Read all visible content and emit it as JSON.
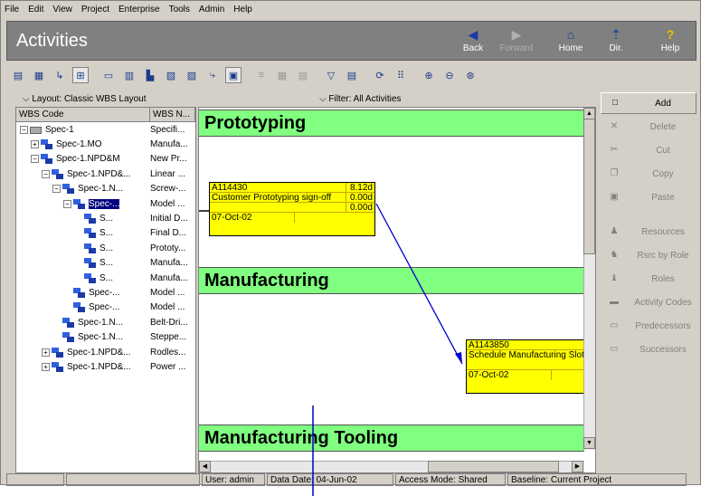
{
  "menu": [
    "File",
    "Edit",
    "View",
    "Project",
    "Enterprise",
    "Tools",
    "Admin",
    "Help"
  ],
  "header": {
    "title": "Activities",
    "nav": [
      {
        "label": "Back",
        "icon": "◀",
        "disabled": false
      },
      {
        "label": "Forward",
        "icon": "▶",
        "disabled": true
      },
      {
        "label": "Home",
        "icon": "⌂",
        "disabled": false
      },
      {
        "label": "Dir.",
        "icon": "⇡",
        "disabled": false
      },
      {
        "label": "Help",
        "icon": "?",
        "disabled": false
      }
    ]
  },
  "layout_label": "Layout: Classic WBS Layout",
  "filter_label": "Filter: All Activities",
  "wbs_headers": {
    "code": "WBS Code",
    "name": "WBS N..."
  },
  "wbs_rows": [
    {
      "code": "Spec-1",
      "name": "Specifi..."
    },
    {
      "code": "Spec-1.MO",
      "name": "Manufa..."
    },
    {
      "code": "Spec-1.NPD&M",
      "name": "New Pr..."
    },
    {
      "code": "Spec-1.NPD&...",
      "name": "Linear ..."
    },
    {
      "code": "Spec-1.N...",
      "name": "Screw-..."
    },
    {
      "code": "Spec-...",
      "name": "Model ..."
    },
    {
      "code": "S...",
      "name": "Initial D..."
    },
    {
      "code": "S...",
      "name": "Final D..."
    },
    {
      "code": "S...",
      "name": "Prototy..."
    },
    {
      "code": "S...",
      "name": "Manufa..."
    },
    {
      "code": "S...",
      "name": "Manufa..."
    },
    {
      "code": "Spec-...",
      "name": "Model ..."
    },
    {
      "code": "Spec-...",
      "name": "Model ..."
    },
    {
      "code": "Spec-1.N...",
      "name": "Belt-Dri..."
    },
    {
      "code": "Spec-1.N...",
      "name": "Steppe..."
    },
    {
      "code": "Spec-1.NPD&...",
      "name": "Rodles..."
    },
    {
      "code": "Spec-1.NPD&...",
      "name": "Power ..."
    }
  ],
  "bands": [
    "Prototyping",
    "Manufacturing",
    "Manufacturing Tooling"
  ],
  "cards": [
    {
      "id": "A114430",
      "name": "Customer Prototyping sign-off",
      "dur": "8.12d",
      "v2": "0.00d",
      "v3": "0.00d",
      "date": "07-Oct-02"
    },
    {
      "id": "A1143850",
      "name": "Schedule Manufacturing Slot",
      "date": "07-Oct-02"
    }
  ],
  "actions": [
    {
      "label": "Add",
      "icon": "□",
      "active": true
    },
    {
      "label": "Delete",
      "icon": "✕",
      "active": false
    },
    {
      "label": "Cut",
      "icon": "✂",
      "active": false
    },
    {
      "label": "Copy",
      "icon": "❐",
      "active": false
    },
    {
      "label": "Paste",
      "icon": "▣",
      "active": false
    },
    {
      "label": "Resources",
      "icon": "♟",
      "active": false
    },
    {
      "label": "Rsrc by Role",
      "icon": "♞",
      "active": false
    },
    {
      "label": "Roles",
      "icon": "♝",
      "active": false
    },
    {
      "label": "Activity Codes",
      "icon": "▬",
      "active": false
    },
    {
      "label": "Predecessors",
      "icon": "▭",
      "active": false
    },
    {
      "label": "Successors",
      "icon": "▭",
      "active": false
    }
  ],
  "status": {
    "user": "User: admin",
    "data_date": "Data Date: 04-Jun-02",
    "access": "Access Mode: Shared",
    "baseline": "Baseline: Current Project"
  }
}
